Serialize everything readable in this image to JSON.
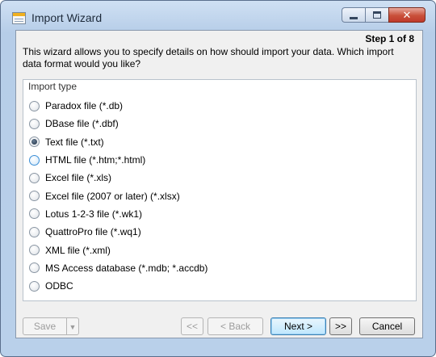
{
  "window": {
    "title": "Import Wizard",
    "close_glyph": "✕"
  },
  "wizard": {
    "step": "Step 1 of 8",
    "intro": "This wizard allows you to specify details on how should import your data. Which import data format would you like?"
  },
  "import_type": {
    "label": "Import type",
    "selected_index": 2,
    "options": [
      "Paradox file (*.db)",
      "DBase file (*.dbf)",
      "Text file (*.txt)",
      "HTML file (*.htm;*.html)",
      "Excel file (*.xls)",
      "Excel file (2007 or later) (*.xlsx)",
      "Lotus 1-2-3 file (*.wk1)",
      "QuattroPro file (*.wq1)",
      "XML file (*.xml)",
      "MS Access database (*.mdb; *.accdb)",
      "ODBC"
    ]
  },
  "buttons": {
    "save": "Save",
    "save_caret": "▼",
    "first": "<<",
    "back": "< Back",
    "next": "Next >",
    "last": ">>",
    "cancel": "Cancel"
  }
}
